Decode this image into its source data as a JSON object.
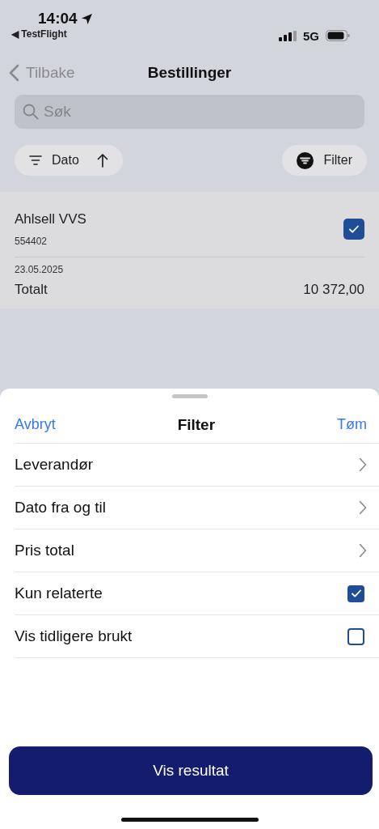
{
  "status_bar": {
    "time": "14:04",
    "back_app": "◀ TestFlight",
    "network": "5G"
  },
  "nav": {
    "back": "Tilbake",
    "title": "Bestillinger"
  },
  "search": {
    "placeholder": "Søk"
  },
  "sort_chip": {
    "label": "Dato"
  },
  "filter_chip": {
    "label": "Filter"
  },
  "orders": [
    {
      "supplier": "Ahlsell VVS",
      "number": "554402",
      "checked": true,
      "date": "23.05.2025",
      "total_label": "Totalt",
      "total": "10 372,00"
    }
  ],
  "sheet": {
    "cancel": "Avbryt",
    "title": "Filter",
    "clear": "Tøm",
    "rows": [
      {
        "kind": "link",
        "label": "Leverandør"
      },
      {
        "kind": "link",
        "label": "Dato fra og til"
      },
      {
        "kind": "link",
        "label": "Pris total"
      },
      {
        "kind": "checkbox",
        "label": "Kun relaterte",
        "checked": true
      },
      {
        "kind": "checkbox",
        "label": "Vis tidligere brukt",
        "checked": false
      }
    ],
    "button": "Vis resultat"
  }
}
